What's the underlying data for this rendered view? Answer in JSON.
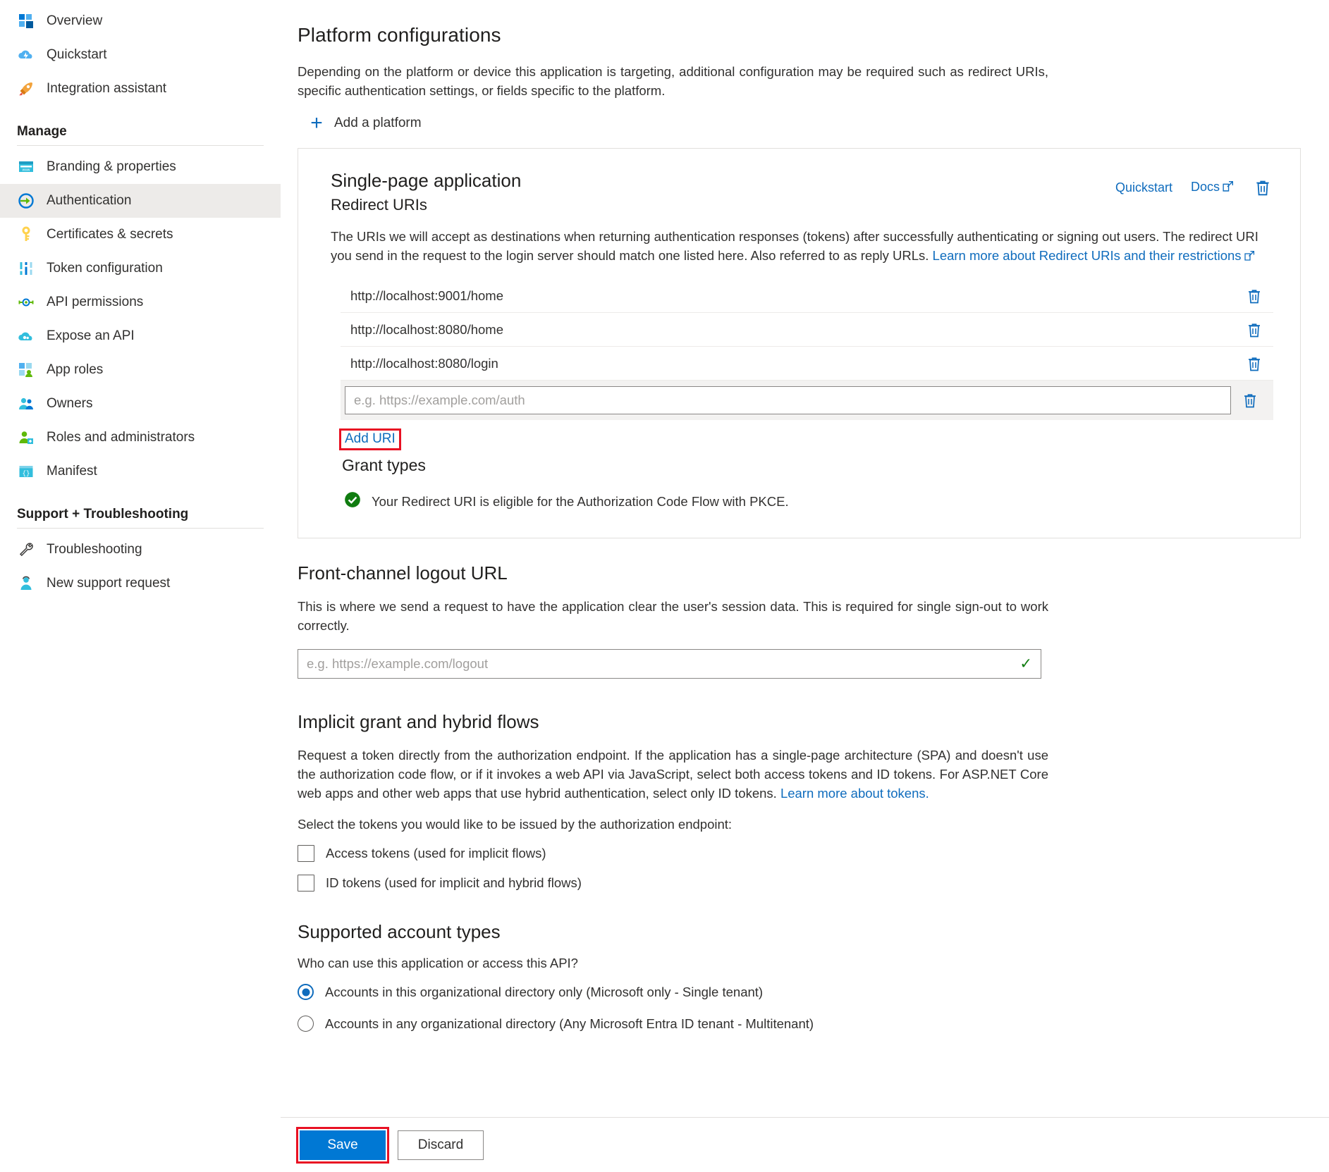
{
  "sidebar": {
    "top_items": [
      {
        "label": "Overview",
        "icon": "grid-cube-icon"
      },
      {
        "label": "Quickstart",
        "icon": "cloud-lightning-icon"
      },
      {
        "label": "Integration assistant",
        "icon": "rocket-icon"
      }
    ],
    "manage": {
      "heading": "Manage",
      "items": [
        {
          "label": "Branding & properties",
          "icon": "browser-window-icon",
          "selected": false
        },
        {
          "label": "Authentication",
          "icon": "arrow-in-circle-icon",
          "selected": true
        },
        {
          "label": "Certificates & secrets",
          "icon": "key-icon",
          "selected": false
        },
        {
          "label": "Token configuration",
          "icon": "sliders-icon",
          "selected": false
        },
        {
          "label": "API permissions",
          "icon": "plug-icon",
          "selected": false
        },
        {
          "label": "Expose an API",
          "icon": "cloud-gear-icon",
          "selected": false
        },
        {
          "label": "App roles",
          "icon": "grid-person-icon",
          "selected": false
        },
        {
          "label": "Owners",
          "icon": "people-icon",
          "selected": false
        },
        {
          "label": "Roles and administrators",
          "icon": "person-badge-icon",
          "selected": false
        },
        {
          "label": "Manifest",
          "icon": "braces-window-icon",
          "selected": false
        }
      ]
    },
    "support": {
      "heading": "Support + Troubleshooting",
      "items": [
        {
          "label": "Troubleshooting",
          "icon": "wrench-icon"
        },
        {
          "label": "New support request",
          "icon": "support-agent-icon"
        }
      ]
    }
  },
  "main": {
    "title": "Platform configurations",
    "description": "Depending on the platform or device this application is targeting, additional configuration may be required such as redirect URIs, specific authentication settings, or fields specific to the platform.",
    "add_platform_label": "Add a platform",
    "platform_card": {
      "title": "Single-page application",
      "subtitle": "Redirect URIs",
      "quickstart_label": "Quickstart",
      "docs_label": "Docs",
      "delete_tooltip": "Delete platform",
      "description_part1": "The URIs we will accept as destinations when returning authentication responses (tokens) after successfully authenticating or signing out users. The redirect URI you send in the request to the login server should match one listed here. Also referred to as reply URLs. ",
      "description_link": "Learn more about Redirect URIs and their restrictions",
      "redirect_uris": [
        "http://localhost:9001/home",
        "http://localhost:8080/home",
        "http://localhost:8080/login"
      ],
      "new_uri_value": "",
      "new_uri_placeholder": "e.g. https://example.com/auth",
      "add_uri_label": "Add URI",
      "grant_types_title": "Grant types",
      "grant_status_text": "Your Redirect URI is eligible for the Authorization Code Flow with PKCE.",
      "grant_status_color": "#107c10",
      "highlight_color": "#e81123"
    },
    "front_channel": {
      "title": "Front-channel logout URL",
      "description": "This is where we send a request to have the application clear the user's session data. This is required for single sign-out to work correctly.",
      "value": "",
      "placeholder": "e.g. https://example.com/logout",
      "valid_mark": "✓",
      "valid_color": "#107c10"
    },
    "implicit": {
      "title": "Implicit grant and hybrid flows",
      "description_part1": "Request a token directly from the authorization endpoint. If the application has a single-page architecture (SPA) and doesn't use the authorization code flow, or if it invokes a web API via JavaScript, select both access tokens and ID tokens. For ASP.NET Core web apps and other web apps that use hybrid authentication, select only ID tokens. ",
      "description_link": "Learn more about tokens.",
      "select_label": "Select the tokens you would like to be issued by the authorization endpoint:",
      "checkboxes": [
        {
          "label": "Access tokens (used for implicit flows)",
          "checked": false
        },
        {
          "label": "ID tokens (used for implicit and hybrid flows)",
          "checked": false
        }
      ]
    },
    "account_types": {
      "title": "Supported account types",
      "question": "Who can use this application or access this API?",
      "options": [
        {
          "label": "Accounts in this organizational directory only (Microsoft only - Single tenant)",
          "selected": true
        },
        {
          "label": "Accounts in any organizational directory (Any Microsoft Entra ID tenant - Multitenant)",
          "selected": false
        }
      ]
    }
  },
  "command_bar": {
    "save_label": "Save",
    "discard_label": "Discard",
    "accent_color": "#0078d4"
  }
}
